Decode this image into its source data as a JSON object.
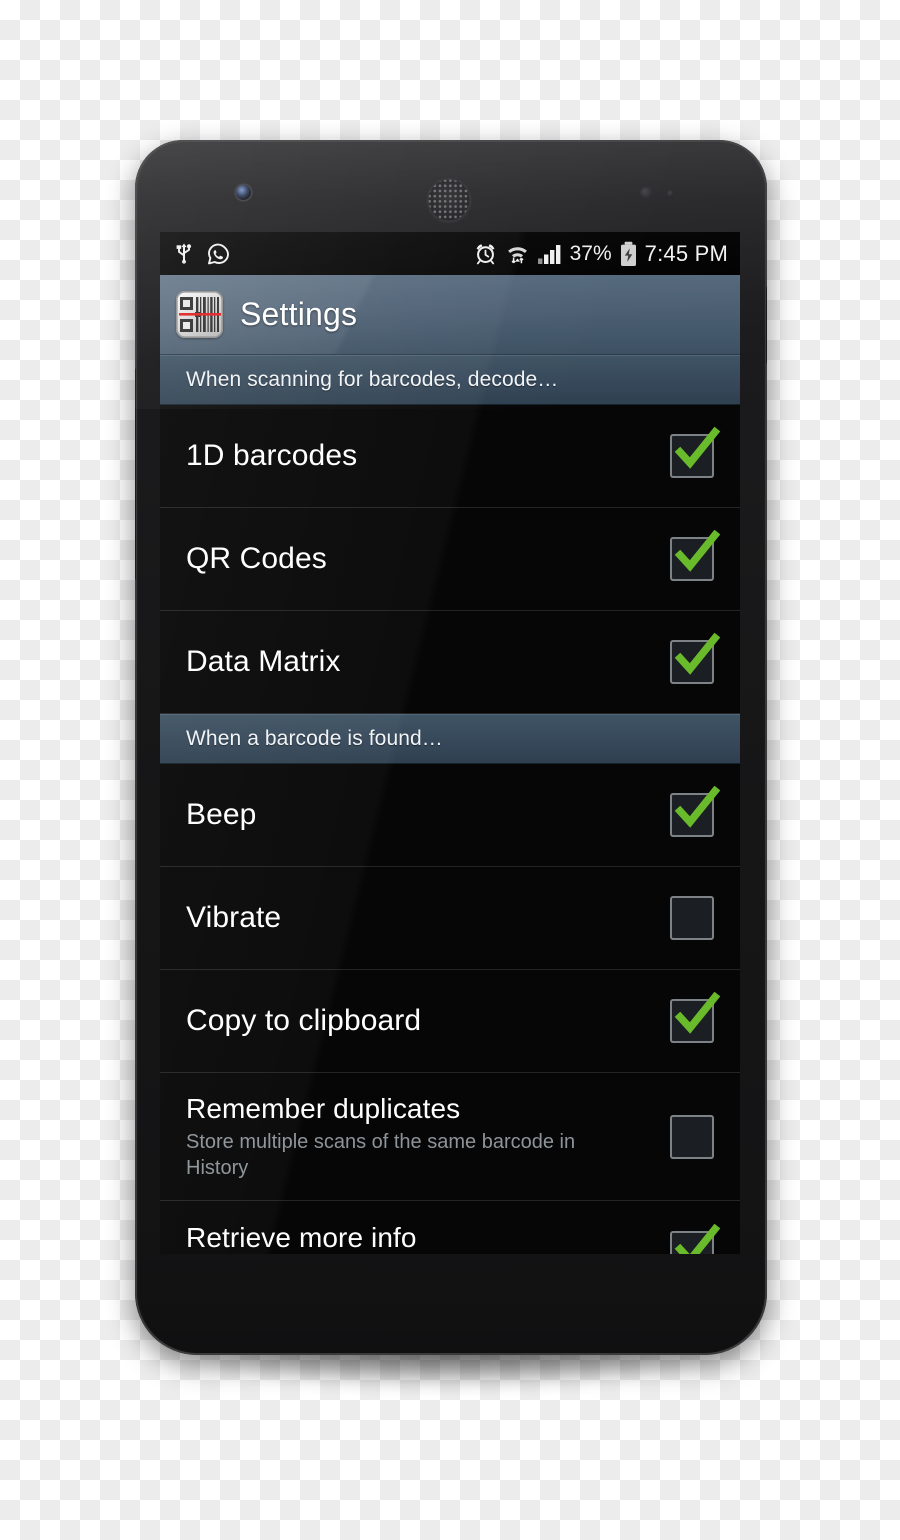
{
  "device": {
    "type": "android-smartphone",
    "front_camera": "front-camera",
    "earpiece": "earpiece-speaker",
    "volume_rocker": "volume-rocker",
    "power_button": "power-button"
  },
  "status_bar": {
    "left_icons": [
      "usb-icon",
      "whatsapp-icon"
    ],
    "right_icons": [
      "alarm-icon",
      "wifi-icon",
      "cellular-signal-icon",
      "battery-charging-icon"
    ],
    "battery_percent": "37%",
    "time": "7:45 PM"
  },
  "action_bar": {
    "icon": "barcode-scanner-app-icon",
    "title": "Settings",
    "background_color": "#4b5e72"
  },
  "colors": {
    "accent_green": "#69bb2b",
    "section_header_bg": "#36485a",
    "list_bg": "#060606",
    "divider": "#242424",
    "summary_text": "#8d9499"
  },
  "sections": [
    {
      "header": "When scanning for barcodes, decode…",
      "items": [
        {
          "title": "1D barcodes",
          "summary": "",
          "checked": true
        },
        {
          "title": "QR Codes",
          "summary": "",
          "checked": true
        },
        {
          "title": "Data Matrix",
          "summary": "",
          "checked": true
        }
      ]
    },
    {
      "header": "When a barcode is found…",
      "items": [
        {
          "title": "Beep",
          "summary": "",
          "checked": true
        },
        {
          "title": "Vibrate",
          "summary": "",
          "checked": false
        },
        {
          "title": "Copy to clipboard",
          "summary": "",
          "checked": true
        },
        {
          "title": "Remember duplicates",
          "summary": "Store multiple scans of the same barcode in History",
          "checked": false
        },
        {
          "title": "Retrieve more info",
          "summary": "",
          "checked": true
        }
      ]
    }
  ]
}
